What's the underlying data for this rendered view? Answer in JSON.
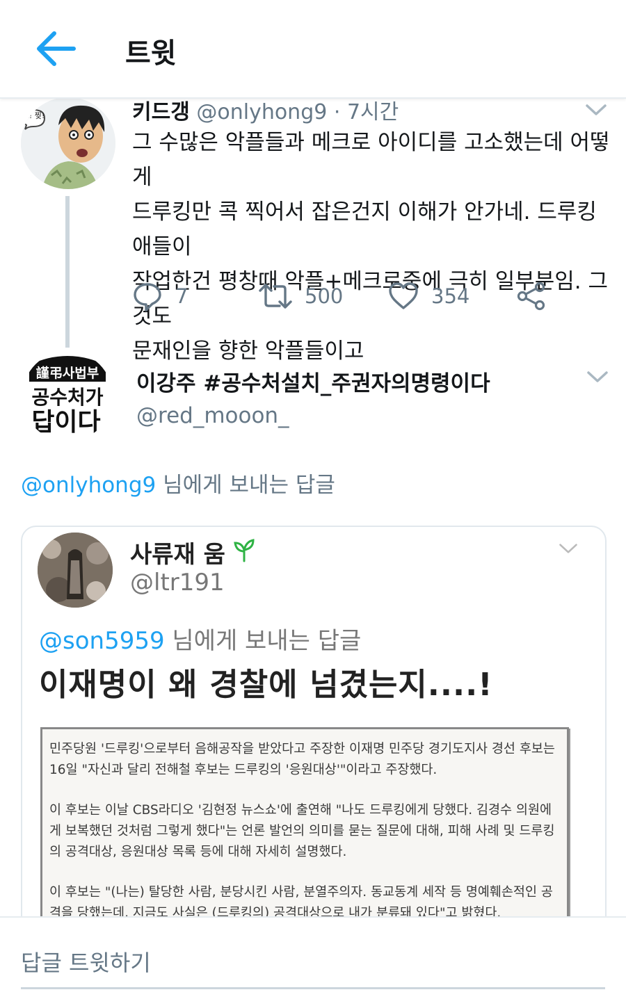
{
  "header": {
    "title": "트윗",
    "back_icon": "arrow-left-icon",
    "accent": "#1da1f2"
  },
  "tweet1": {
    "name": "키드갱",
    "handle": "@onlyhong9",
    "time": "· 7시간",
    "avatar_caption": "오! 찢!",
    "text_lines": [
      "그 수많은 악플들과 메크로 아이디를 고소했는데 어떻게",
      "드루킹만 콕 찍어서 잡은건지 이해가 안가네. 드루킹 애들이",
      "작업한건 평창때 악플+메크로중에 극히 일부분임. 그것도",
      "문재인을 향한 악플들이고"
    ],
    "actions": {
      "replies": "7",
      "retweets": "500",
      "likes": "354"
    }
  },
  "tweet2": {
    "name": "이강주 #공수처설치_주권자의명령이다",
    "handle": "@red_mooon_",
    "avatar_lines": [
      "謹弔사법부",
      "공수처가",
      "답이다"
    ],
    "replying_handle": "@onlyhong9",
    "replying_suffix": " 님에게 보내는 답글",
    "quoted": {
      "name": "사류재 움",
      "handle": "@ltr191",
      "reply_handle": "@son5959",
      "reply_suffix": " 님에게 보내는 답글",
      "headline": "이재명이 왜 경찰에 넘겼는지....!",
      "article_paragraphs": [
        "민주당원 '드루킹'으로부터 음해공작을 받았다고 주장한 이재명 민주당 경기도지사 경선 후보는 16일 \"자신과 달리 전해철 후보는 드루킹의 '응원대상'\"이라고 주장했다.",
        "이 후보는 이날 CBS라디오 '김현정 뉴스쇼'에 출연해 \"나도 드루킹에게 당했다. 김경수 의원에게 보복했던 것처럼 그렇게 했다\"는 언론 발언의 의미를 묻는 질문에 대해, 피해 사례 및 드루킹의 공격대상, 응원대상 목록 등에 대해 자세히 설명했다.",
        "이 후보는 \"(나는) 탈당한 사람, 분당시킨 사람, 분열주의자. 동교동계 세작 등 명예훼손적인 공격을 당했는데, 지금도 사실은 (드루킹의) 공격대상으로 내가 분류돼 있다\"고 밝혔다."
      ]
    }
  },
  "reply_box": {
    "placeholder": "답글 트윗하기"
  }
}
